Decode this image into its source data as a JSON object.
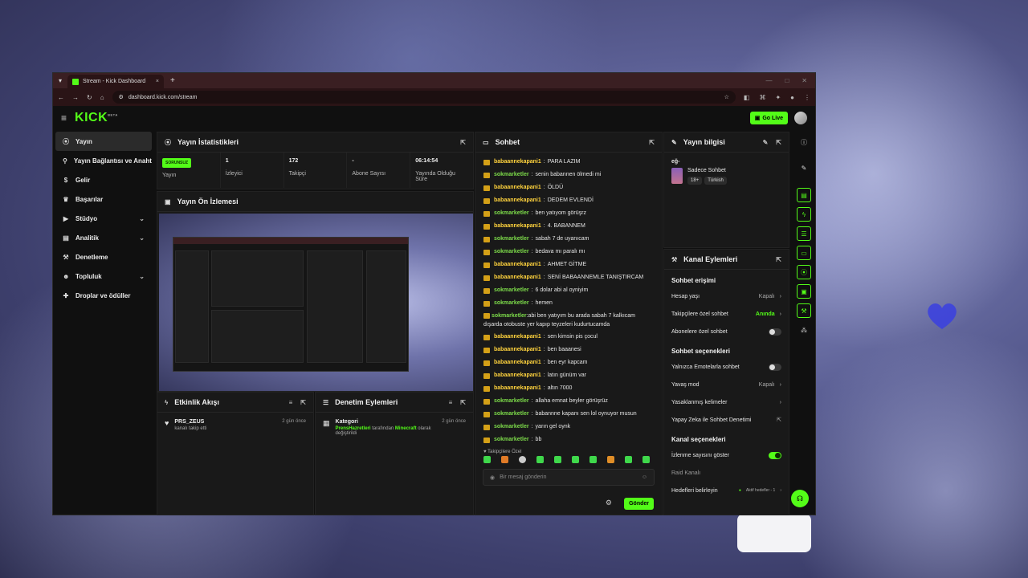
{
  "browser": {
    "tab_title": "Stream - Kick Dashboard",
    "url": "dashboard.kick.com/stream"
  },
  "header": {
    "logo": "KICK",
    "logo_badge": "BETA",
    "go_live_label": "Go Live"
  },
  "sidebar": {
    "items": [
      {
        "label": "Yayın",
        "icon": "broadcast-icon",
        "active": true
      },
      {
        "label": "Yayın Bağlantısı ve Anahtarı",
        "icon": "link-icon"
      },
      {
        "label": "Gelir",
        "icon": "money-icon"
      },
      {
        "label": "Başarılar",
        "icon": "trophy-icon"
      },
      {
        "label": "Stüdyo",
        "icon": "camera-icon",
        "expandable": true
      },
      {
        "label": "Analitik",
        "icon": "chart-icon",
        "expandable": true
      },
      {
        "label": "Denetleme",
        "icon": "hammer-icon"
      },
      {
        "label": "Topluluk",
        "icon": "people-icon",
        "expandable": true
      },
      {
        "label": "Droplar ve ödüller",
        "icon": "gift-icon"
      }
    ]
  },
  "stats": {
    "title": "Yayın İstatistikleri",
    "items": [
      {
        "value": "SORUNSUZ",
        "label": "Yayın"
      },
      {
        "value": "1",
        "label": "İzleyici"
      },
      {
        "value": "172",
        "label": "Takipçi"
      },
      {
        "value": "-",
        "label": "Abone Sayısı"
      },
      {
        "value": "06:14:54",
        "label": "Yayında Olduğu Süre"
      }
    ]
  },
  "preview": {
    "title": "Yayın Ön İzlemesi"
  },
  "activity": {
    "title": "Etkinlik Akışı",
    "items": [
      {
        "user": "PRS_ZEUS",
        "text": "kanalı takip etti",
        "time": "2 gün önce"
      }
    ]
  },
  "moderation": {
    "title": "Denetim Eylemleri",
    "items": [
      {
        "title": "Kategori",
        "actor": "PrensHazretleri",
        "mid": "tarafından",
        "category": "Minecraft",
        "tail": "olarak değiştirildi",
        "time": "2 gün önce"
      }
    ]
  },
  "chat": {
    "title": "Sohbet",
    "messages": [
      {
        "user": "babaannekapani1",
        "text": "PARA LAZIM",
        "color": "u1"
      },
      {
        "user": "sokmarketler",
        "text": "senin babannen ölmedi mi",
        "color": "u2"
      },
      {
        "user": "babaannekapani1",
        "text": "ÖLDÜ",
        "color": "u1"
      },
      {
        "user": "babaannekapani1",
        "text": "DEDEM EVLENDİ",
        "color": "u1"
      },
      {
        "user": "sokmarketler",
        "text": "ben yatıyom görüşrz",
        "color": "u2"
      },
      {
        "user": "babaannekapani1",
        "text": "4. BABANNEM",
        "color": "u1"
      },
      {
        "user": "sokmarketler",
        "text": "sabah 7 de uyanıcam",
        "color": "u2"
      },
      {
        "user": "sokmarketler",
        "text": "bedava mı paralı mı",
        "color": "u2"
      },
      {
        "user": "babaannekapani1",
        "text": "AHMET GİTME",
        "color": "u1"
      },
      {
        "user": "babaannekapani1",
        "text": "SENİ BABAANNEMLE TANIŞTIRCAM",
        "color": "u1"
      },
      {
        "user": "sokmarketler",
        "text": "6 dolar abi al oyniyim",
        "color": "u2"
      },
      {
        "user": "sokmarketler",
        "text": "hemen",
        "color": "u2"
      },
      {
        "user": "sokmarketler",
        "text": "abi ben yatıyım bu arada sabah 7 kalkıcam dışarda otobuste yer kapıp teyzeleri kudurtucamda",
        "color": "u2",
        "wrap": true
      },
      {
        "user": "babaannekapani1",
        "text": "sen kimsin pis çocul",
        "color": "u1"
      },
      {
        "user": "babaannekapani1",
        "text": "ben baaanesi",
        "color": "u1"
      },
      {
        "user": "babaannekapani1",
        "text": "ben eyr kapcam",
        "color": "u1"
      },
      {
        "user": "babaannekapani1",
        "text": "latın günüm var",
        "color": "u1"
      },
      {
        "user": "babaannekapani1",
        "text": "altın 7000",
        "color": "u1"
      },
      {
        "user": "sokmarketler",
        "text": "allaha emnat beyler görüşrüz",
        "color": "u2"
      },
      {
        "user": "sokmarketler",
        "text": "babannne kapanı sen lol oynuyor musun",
        "color": "u2"
      },
      {
        "user": "sokmarketler",
        "text": "yarın gel oynk",
        "color": "u2"
      },
      {
        "user": "sokmarketler",
        "text": "bb",
        "color": "u2"
      }
    ],
    "followers_only_label": "Takipçilere Özel",
    "input_placeholder": "Bir mesaj gönderin",
    "send_label": "Gönder"
  },
  "stream_info": {
    "title": "Yayın bilgisi",
    "stream_title": "eğ-",
    "category": "Sadece Sohbet",
    "tags": [
      "18+",
      "Türkish"
    ]
  },
  "channel_actions": {
    "title": "Kanal Eylemleri",
    "chat_access": "Sohbet erişimi",
    "account_age": {
      "label": "Hesap yaşı",
      "value": "Kapalı"
    },
    "followers_only": {
      "label": "Takipçilere özel sohbet",
      "value": "Anında"
    },
    "subs_only": {
      "label": "Abonelere özel sohbet"
    },
    "chat_options": "Sohbet seçenekleri",
    "emotes_only": {
      "label": "Yalnızca Emotelarla sohbet"
    },
    "slow_mode": {
      "label": "Yavaş mod",
      "value": "Kapalı"
    },
    "banned_words": {
      "label": "Yasaklanmış kelimeler"
    },
    "ai_moderation": {
      "label": "Yapay Zeka ile Sohbet Denetimi"
    },
    "channel_options": "Kanal seçenekleri",
    "show_viewers": {
      "label": "İzlenme sayısını göster"
    },
    "raid": {
      "label": "Raid Kanalı"
    },
    "goals": {
      "label": "Hedefleri belirleyin",
      "value": "Aktif hedefler - 1"
    }
  },
  "colors": {
    "accent": "#53fc18",
    "panel": "#191919",
    "bg": "#101010"
  }
}
